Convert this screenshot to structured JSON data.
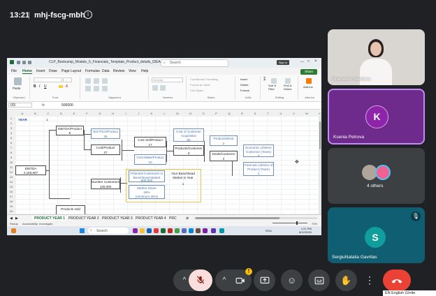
{
  "meeting": {
    "time": "13:21",
    "separator": "|",
    "code": "mhj-fscg-mbh"
  },
  "excel": {
    "title": "CLP_Bootcamp_Module_5_Financials_Template_Product_details_IDEA",
    "search_placeholder": "Search",
    "sign_in": "Sign in",
    "share": "Share",
    "menu": [
      "File",
      "Home",
      "Insert",
      "Draw",
      "Page Layout",
      "Formulas",
      "Data",
      "Review",
      "View",
      "Help"
    ],
    "ribbon": {
      "paste": "Paste",
      "font_name": "Calibri",
      "font_size": "11",
      "number_format": "General",
      "conditional": "Conditional Formatting",
      "format_table": "Format as Table",
      "cell_styles": "Cell Styles",
      "insert": "Insert",
      "delete": "Delete",
      "format": "Format",
      "sort_filter": "Sort & Filter",
      "find_select": "Find & Select",
      "addins": "Add-ins",
      "groups": [
        "Clipboard",
        "Font",
        "Alignment",
        "Number",
        "Styles",
        "Cells",
        "Editing",
        "Add-ins"
      ]
    },
    "formula_bar": {
      "cell_ref": "I33",
      "fx": "fx",
      "value": "500000"
    },
    "col_headers": [
      "A",
      "B",
      "C",
      "D",
      "E",
      "F",
      "G",
      "H",
      "I",
      "J",
      "K",
      "L",
      "M",
      "N",
      "O",
      "P",
      "Q",
      "R",
      "S",
      "T",
      "U",
      "V",
      "W",
      "X"
    ],
    "row_headers": [
      "1",
      "2",
      "3",
      "4",
      "5",
      "6",
      "7",
      "8",
      "9",
      "10",
      "11",
      "12",
      "13",
      "14",
      "15",
      "16",
      "17",
      "18",
      "19",
      "20"
    ],
    "year_label": "YEAR",
    "year_value": "1",
    "nodes": {
      "ebitda": {
        "label": "EBITDA",
        "value": "4,166,667"
      },
      "ebitda_product": {
        "label": "EBITDA/Product",
        "value": "8"
      },
      "net_price": {
        "label": "Net Price/Product",
        "value": "35"
      },
      "cost_product": {
        "label": "Cost/Product",
        "value": "27"
      },
      "cost_sell": {
        "label": "Cost Sell/Product",
        "value": "17"
      },
      "cost_make": {
        "label": "Cost Make/Product",
        "value": "10"
      },
      "cost_acq": {
        "label": "Cost of Customer Acquisition",
        "value": "50"
      },
      "products_customer": {
        "label": "Products/Customer",
        "value": "3"
      },
      "products_deal": {
        "label": "Products/Deal",
        "value": "2"
      },
      "deals_customer": {
        "label": "Deals/Customer",
        "value": "2"
      },
      "econ_lifetime": {
        "label": "Economic Lifetime Customer (Years)",
        "value": "1"
      },
      "forecast_lifetime": {
        "label": "Forecast Lifetime of Product (Years)",
        "value": "1"
      },
      "number_customers": {
        "label": "Number Customers",
        "value": "125,000"
      },
      "potential_customers": {
        "label": "Potential Customers in Beachhead Market",
        "value": "500,000"
      },
      "market_share": {
        "label": "Market Share",
        "value": "25%"
      },
      "market_share_min": "(minimum 20%)",
      "beachhead_year": {
        "label": "Your Beachhead Market in Year",
        "value": "1"
      },
      "products_sold": {
        "label": "Products sold"
      }
    },
    "sheet_tabs": [
      "PRODUCT YEAR 1",
      "PRODUCT YEAR 2",
      "PRODUCT YEAR 3",
      "PRODUCT YEAR 4",
      "PRC"
    ],
    "status": {
      "ready": "Ready",
      "accessibility": "Accessibility: Investigate",
      "zoom": "70%"
    },
    "taskbar": {
      "search": "Search",
      "lang": "ROU",
      "time": "1:21 PM",
      "date": "8/12/2026"
    }
  },
  "participants": [
    {
      "name": "Gherasim Svetlana",
      "initial": ""
    },
    {
      "name": "Ksenia Petrova",
      "initial": "K"
    },
    {
      "name": "4 others",
      "initial": ""
    },
    {
      "name": "SergiuNatalia Gavrilas",
      "initial": "S"
    }
  ],
  "captions": "EN English (Unite",
  "colors": {
    "meet_bg": "#202124",
    "purple_tile": "#6f2b8c",
    "teal_tile": "#0f5e72",
    "end_call": "#ea4335",
    "excel_green": "#1e6b35"
  },
  "controls": [
    "chevron-up-icon",
    "mic-off-icon",
    "chevron-up-icon",
    "camera-icon",
    "present-icon",
    "emoji-icon",
    "captions-icon",
    "raise-hand-icon",
    "more-icon",
    "end-call-icon"
  ]
}
